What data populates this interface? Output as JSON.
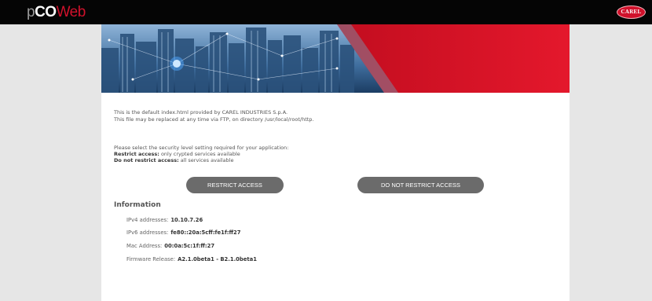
{
  "header": {
    "logo_p": "p",
    "logo_co": "CO",
    "logo_web": "Web",
    "brand_badge": "CAREL"
  },
  "intro": {
    "line1": "This is the default index.html provided by CAREL INDUSTRIES S.p.A.",
    "line2": "This file may be replaced at any time via FTP, on directory /usr/local/root/http."
  },
  "security": {
    "prompt": "Please select the security level setting required for your application:",
    "restrict_label": "Restrict access:",
    "restrict_desc": " only crypted services available",
    "norestrict_label": "Do not restrict access:",
    "norestrict_desc": " all services available"
  },
  "buttons": {
    "restrict": "RESTRICT ACCESS",
    "no_restrict": "DO NOT RESTRICT ACCESS"
  },
  "information": {
    "title": "Information",
    "rows": [
      {
        "label": "IPv4 addresses:",
        "value": "10.10.7.26"
      },
      {
        "label": "IPv6 addresses:",
        "value": "fe80::20a:5cff:fe1f:ff27"
      },
      {
        "label": "Mac Address:",
        "value": "00:0a:5c:1f:ff:27"
      },
      {
        "label": "Firmware Release:",
        "value": "A2.1.0beta1 - B2.1.0beta1"
      }
    ]
  },
  "colors": {
    "brand_red": "#d0112b",
    "topbar": "#050505",
    "button_gray": "#6b6b6b",
    "background": "#e6e6e6"
  }
}
